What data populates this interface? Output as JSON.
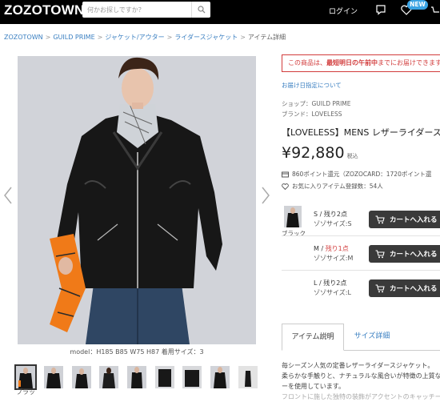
{
  "header": {
    "logo": "ZOZOTOWN",
    "search_placeholder": "何かお探しですか？",
    "login": "ログイン",
    "new_badge": "NEW"
  },
  "breadcrumb": {
    "items": [
      "ZOZOTOWN",
      "GUILD PRIME",
      "ジャケット/アウター",
      "ライダースジャケット"
    ],
    "separator": ">",
    "current": "アイテム詳細"
  },
  "gallery": {
    "model_info": "model：H185 B85 W75 H87 着用サイズ：3",
    "thumb_label": "ブラッ"
  },
  "product": {
    "notice_prefix": "この商品は、",
    "notice_bold": "最短明日の午前中",
    "notice_suffix": "までにお届けできます",
    "delivery_link": "お届け日指定について",
    "shop": "ショップ：GUILD PRIME",
    "brand": "ブランド：LOVELESS",
    "title": "【LOVELESS】MENS レザーライダース",
    "price": "¥92,880",
    "tax": "税込",
    "points": "860ポイント還元（ZOZOCARD：1720ポイント還",
    "favorites": "お気に入りアイテム登録数：54人"
  },
  "variant": {
    "color": "ブラック",
    "sizes": [
      {
        "stock_prefix": "S / ",
        "stock": "残り2点",
        "low": false,
        "zozo": "ゾゾサイズ:S"
      },
      {
        "stock_prefix": "M / ",
        "stock": "残り1点",
        "low": true,
        "zozo": "ゾゾサイズ:M"
      },
      {
        "stock_prefix": "L / ",
        "stock": "残り2点",
        "low": false,
        "zozo": "ゾゾサイズ:L"
      }
    ],
    "cart_label": "カートへ入れる"
  },
  "tabs": {
    "description": "アイテム説明",
    "size": "サイズ詳細"
  },
  "description": [
    "毎シーズン人気の定番レザーライダースジャケット。",
    "柔らかな手触りと、ナチュラルな風合いが特徴の上質なラム",
    "ーを使用しています。",
    "フロントに施した独特の装飾がアクセントのキャッチーなデザイン"
  ],
  "colors": {
    "accent_red": "#d23c3c",
    "link_blue": "#3a7fc1",
    "cart_bg": "#3a3a3a",
    "badge_blue": "#3aa3e3"
  }
}
